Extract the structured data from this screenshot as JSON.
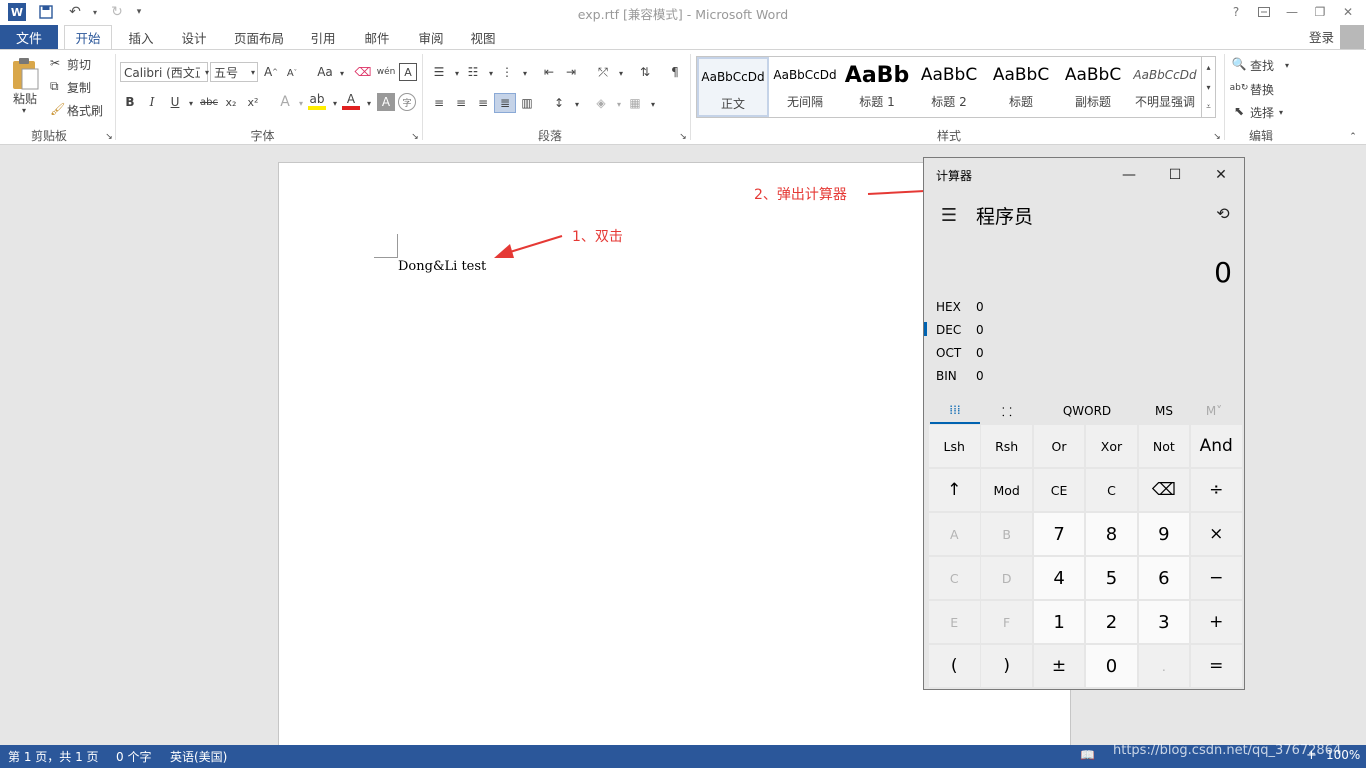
{
  "app": {
    "title": "exp.rtf [兼容模式] - Microsoft Word",
    "logo": "W",
    "qa_icons": [
      "save-icon",
      "undo-icon",
      "redo-icon",
      "customize-icon"
    ],
    "help": "?",
    "login": "登录"
  },
  "tabs": {
    "file": "文件",
    "items": [
      "开始",
      "插入",
      "设计",
      "页面布局",
      "引用",
      "邮件",
      "审阅",
      "视图"
    ],
    "active": "开始"
  },
  "ribbon": {
    "clipboard": {
      "paste": "粘贴",
      "cut": "剪切",
      "copy": "复制",
      "format_painter": "格式刷",
      "label": "剪贴板"
    },
    "font": {
      "family": "Calibri (西文正",
      "size": "五号",
      "label": "字体",
      "change_case": "Aa",
      "bold": "B",
      "italic": "I",
      "underline": "U",
      "strike": "abc"
    },
    "paragraph": {
      "label": "段落"
    },
    "styles": {
      "label": "样式",
      "items": [
        {
          "preview": "AaBbCcDd",
          "name": "正文"
        },
        {
          "preview": "AaBbCcDd",
          "name": "无间隔"
        },
        {
          "preview": "AaBb",
          "name": "标题 1"
        },
        {
          "preview": "AaBbC",
          "name": "标题 2"
        },
        {
          "preview": "AaBbC",
          "name": "标题"
        },
        {
          "preview": "AaBbC",
          "name": "副标题"
        },
        {
          "preview": "AaBbCcDd",
          "name": "不明显强调"
        }
      ]
    },
    "editing": {
      "find": "查找",
      "replace": "替换",
      "select": "选择",
      "label": "编辑"
    }
  },
  "document": {
    "text": "Dong&Li test"
  },
  "annotations": {
    "first": "1、双击",
    "second": "2、弹出计算器"
  },
  "calculator": {
    "title": "计算器",
    "mode": "程序员",
    "display": "0",
    "radix": [
      {
        "label": "HEX",
        "value": "0"
      },
      {
        "label": "DEC",
        "value": "0"
      },
      {
        "label": "OCT",
        "value": "0"
      },
      {
        "label": "BIN",
        "value": "0"
      }
    ],
    "mode_tabs": [
      "QWORD",
      "MS",
      "M˅"
    ],
    "keys": [
      [
        "Lsh",
        "Rsh",
        "Or",
        "Xor",
        "Not",
        "And"
      ],
      [
        "↑",
        "Mod",
        "CE",
        "C",
        "⌫",
        "÷"
      ],
      [
        "A",
        "B",
        "7",
        "8",
        "9",
        "×"
      ],
      [
        "C",
        "D",
        "4",
        "5",
        "6",
        "−"
      ],
      [
        "E",
        "F",
        "1",
        "2",
        "3",
        "+"
      ],
      [
        "(",
        ")",
        "±",
        "0",
        ".",
        "="
      ]
    ]
  },
  "status": {
    "page": "第 1 页，共 1 页",
    "words": "0 个字",
    "language": "英语(美国)",
    "zoom": "100%"
  },
  "watermark": "https://blog.csdn.net/qq_37672864"
}
